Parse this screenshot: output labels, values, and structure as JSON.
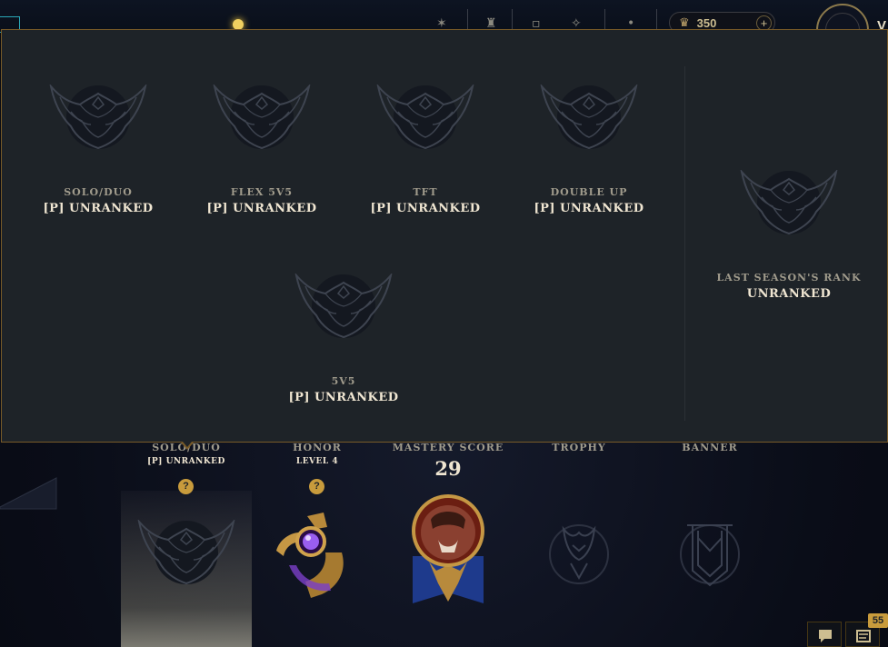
{
  "nav": {
    "currency_amount": "350",
    "currency_add": "+",
    "summoner_initial": "V"
  },
  "ranked_popup": {
    "queues": [
      {
        "queue": "SOLO/DUO",
        "rank": "[P] UNRANKED"
      },
      {
        "queue": "FLEX 5V5",
        "rank": "[P] UNRANKED"
      },
      {
        "queue": "TFT",
        "rank": "[P] UNRANKED"
      },
      {
        "queue": "DOUBLE UP",
        "rank": "[P] UNRANKED"
      },
      {
        "queue": "5V5",
        "rank": "[P] UNRANKED"
      }
    ],
    "last_season": {
      "label": "LAST SEASON'S RANK",
      "rank": "UNRANKED"
    }
  },
  "showcase": {
    "ranked": {
      "title": "SOLO/DUO",
      "sub": "[P] UNRANKED",
      "help": "?"
    },
    "honor": {
      "title": "HONOR",
      "sub": "LEVEL 4",
      "help": "?"
    },
    "mastery": {
      "title": "MASTERY SCORE",
      "score": "29"
    },
    "trophy": {
      "title": "TROPHY"
    },
    "banner": {
      "title": "BANNER"
    }
  },
  "footer": {
    "notification_count": "55"
  },
  "colors": {
    "gold": "#c89b3c",
    "popup_bg": "#1e2328",
    "border_gold": "#785a28",
    "text_light": "#f0e6d2",
    "text_muted": "#a09b8c"
  }
}
